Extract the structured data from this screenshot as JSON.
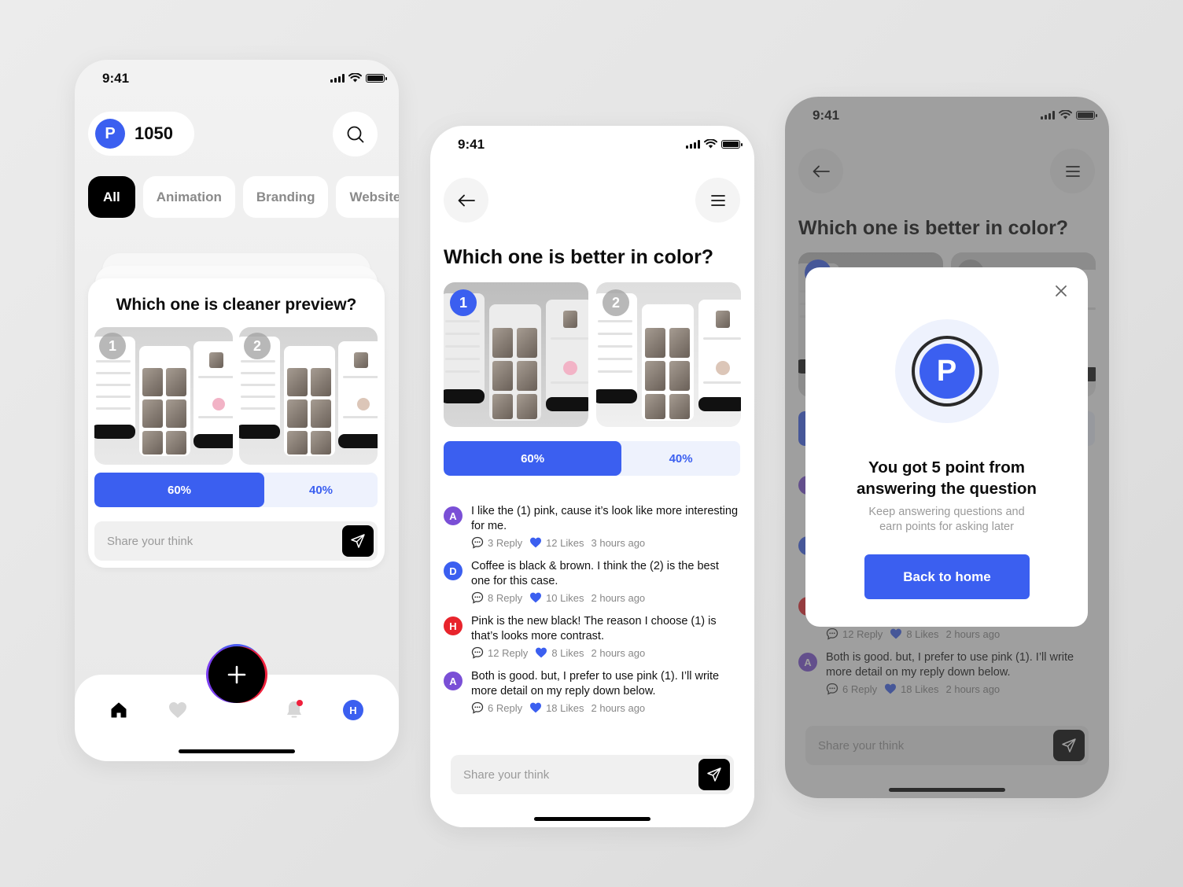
{
  "colors": {
    "accent": "#3b5ff0",
    "accent_light": "#eef2fd",
    "avatar_purple": "#7a4fd6",
    "avatar_blue": "#3b5ff0",
    "avatar_red": "#e8242c",
    "notification_dot": "#f0203c"
  },
  "status_bar": {
    "time": "9:41"
  },
  "home_screen": {
    "points_badge_letter": "P",
    "points": "1050",
    "search_icon": "search-icon",
    "categories": [
      {
        "label": "All",
        "active": true
      },
      {
        "label": "Animation",
        "active": false
      },
      {
        "label": "Branding",
        "active": false
      },
      {
        "label": "Website",
        "active": false
      }
    ],
    "question_card": {
      "title": "Which one is cleaner preview?",
      "options": [
        {
          "number": "1",
          "percent_label": "60%",
          "percent": 60
        },
        {
          "number": "2",
          "percent_label": "40%",
          "percent": 40
        }
      ],
      "input_placeholder": "Share your think"
    },
    "tab_bar": {
      "items": [
        "home-icon",
        "heart-icon",
        "plus-icon",
        "bell-icon",
        "profile-avatar"
      ],
      "profile_initial": "H",
      "notification_unread": true
    }
  },
  "detail_screen": {
    "title": "Which one is better in color?",
    "options": [
      {
        "number": "1",
        "percent_label": "60%",
        "percent": 60,
        "selected": true
      },
      {
        "number": "2",
        "percent_label": "40%",
        "percent": 40,
        "selected": false
      }
    ],
    "comments": [
      {
        "initial": "A",
        "color": "#7a4fd6",
        "text": "I like the (1) pink, cause it’s look like more interesting for me.",
        "replies": "3 Reply",
        "likes": "12 Likes",
        "time": "3 hours ago"
      },
      {
        "initial": "D",
        "color": "#3b5ff0",
        "text": "Coffee is black & brown. I think the (2) is the best one for this case.",
        "replies": "8 Reply",
        "likes": "10 Likes",
        "time": "2 hours ago"
      },
      {
        "initial": "H",
        "color": "#e8242c",
        "text": "Pink is the new black! The reason I choose (1) is that’s looks more contrast.",
        "replies": "12 Reply",
        "likes": "8 Likes",
        "time": "2 hours ago"
      },
      {
        "initial": "A",
        "color": "#7a4fd6",
        "text": "Both is good. but, I prefer to use pink (1). I’ll write more detail on my reply down below.",
        "replies": "6 Reply",
        "likes": "18 Likes",
        "time": "2 hours ago"
      }
    ],
    "input_placeholder": "Share your think"
  },
  "reward_screen": {
    "title": "Which one is better in color?",
    "background_comments": [
      {
        "initial": "H",
        "color": "#e8242c",
        "replies": "12 Reply",
        "likes": "8 Likes",
        "time": "2 hours ago"
      },
      {
        "initial": "A",
        "color": "#7a4fd6",
        "text": "Both is good. but, I prefer to use pink (1). I’ll write more detail on my reply down below.",
        "replies": "6 Reply",
        "likes": "18 Likes",
        "time": "2 hours ago"
      }
    ],
    "modal": {
      "badge_letter": "P",
      "title_line1": "You got 5 point from",
      "title_line2": "answering the question",
      "subtitle_line1": "Keep answering questions and",
      "subtitle_line2": "earn points for asking later",
      "button_label": "Back to home"
    },
    "input_placeholder": "Share your think"
  }
}
